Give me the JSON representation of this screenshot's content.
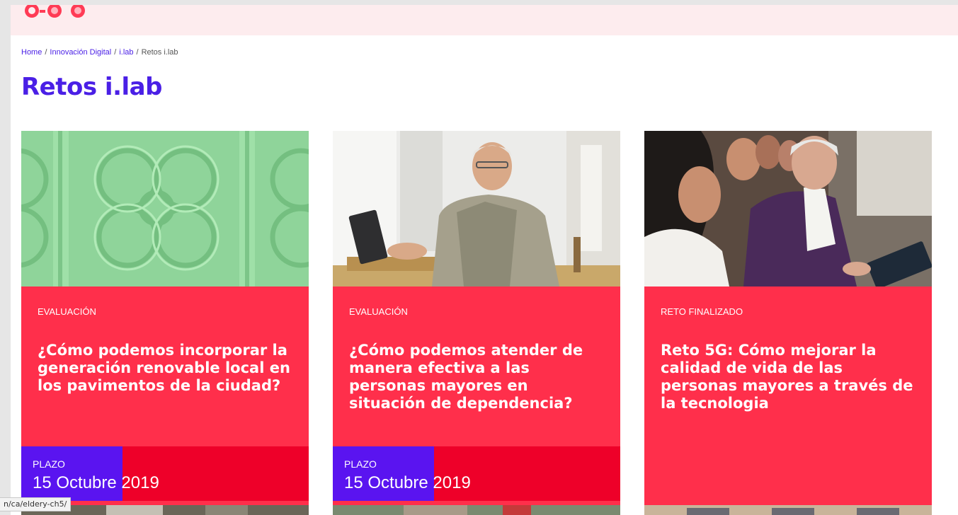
{
  "breadcrumb": {
    "items": [
      {
        "label": "Home"
      },
      {
        "label": "Innovación Digital"
      },
      {
        "label": "i.lab"
      },
      {
        "label": "Retos i.lab"
      }
    ],
    "separator": "/"
  },
  "page_title": "Retos i.lab",
  "cards": [
    {
      "status": "EVALUACIÓN",
      "title": "¿Cómo podemos incorporar la generación renovable local en los pavimentos de la ciudad?",
      "deadline_label": "PLAZO",
      "deadline_date": "15 Octubre 2019"
    },
    {
      "status": "EVALUACIÓN",
      "title": "¿Cómo podemos atender de manera efectiva a las personas mayores en situación de dependencia?",
      "deadline_label": "PLAZO",
      "deadline_date": "15 Octubre 2019"
    },
    {
      "status": "RETO FINALIZADO",
      "title": "Reto 5G: Cómo mejorar la calidad de vida de las personas mayores a través de la tecnologia"
    }
  ],
  "status_bar_url": "n/ca/eldery-ch5/",
  "colors": {
    "accent_violet": "#4a1fe6",
    "card_red": "#ff2f4b",
    "deadline_red": "#ee0029",
    "deadline_violet": "#5a14f0",
    "topbar_pink": "#fdecee"
  }
}
